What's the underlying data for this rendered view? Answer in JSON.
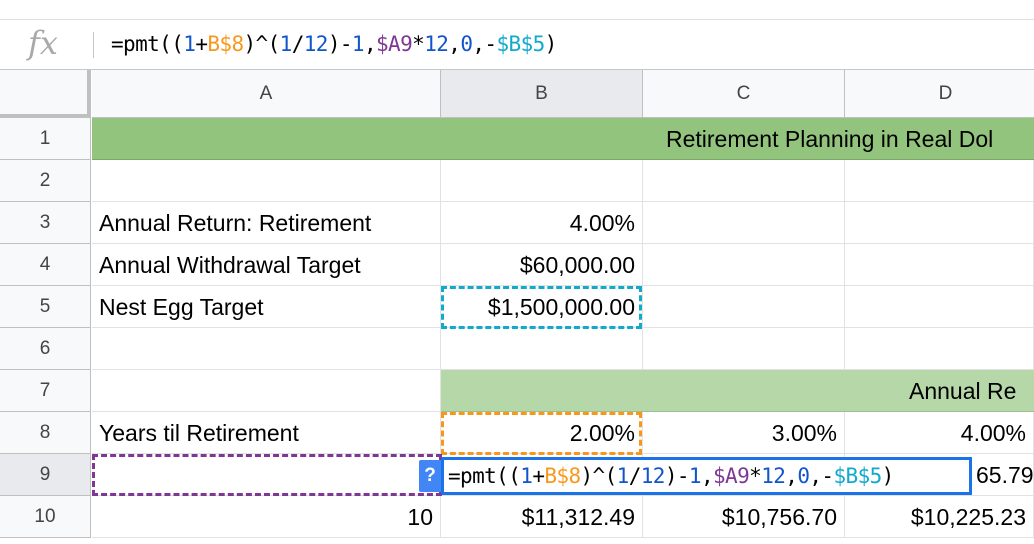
{
  "formula_bar": {
    "fx_label": "fx",
    "tokens": [
      {
        "t": "=pmt((",
        "c": "op"
      },
      {
        "t": "1",
        "c": "num"
      },
      {
        "t": "+",
        "c": "op"
      },
      {
        "t": "B$8",
        "c": "ref1"
      },
      {
        "t": ")^(",
        "c": "op"
      },
      {
        "t": "1",
        "c": "num"
      },
      {
        "t": "/",
        "c": "op"
      },
      {
        "t": "12",
        "c": "num"
      },
      {
        "t": ")-",
        "c": "op"
      },
      {
        "t": "1",
        "c": "num"
      },
      {
        "t": ",",
        "c": "op"
      },
      {
        "t": "$A9",
        "c": "ref2"
      },
      {
        "t": "*",
        "c": "op"
      },
      {
        "t": "12",
        "c": "num"
      },
      {
        "t": ",",
        "c": "op"
      },
      {
        "t": "0",
        "c": "num"
      },
      {
        "t": ",-",
        "c": "op"
      },
      {
        "t": "$B$5",
        "c": "ref3"
      },
      {
        "t": ")",
        "c": "op"
      }
    ]
  },
  "columns": [
    "A",
    "B",
    "C",
    "D"
  ],
  "rows": [
    "1",
    "2",
    "3",
    "4",
    "5",
    "6",
    "7",
    "8",
    "9",
    "10"
  ],
  "title": "Retirement Planning in Real Dol",
  "annual_return_header": "Annual Re",
  "cells": {
    "A3": "Annual Return: Retirement",
    "B3": "4.00%",
    "A4": "Annual Withdrawal Target",
    "B4": "$60,000.00",
    "A5": "Nest Egg Target",
    "B5": "$1,500,000.00",
    "A8": "Years til Retirement",
    "B8": "2.00%",
    "C8": "3.00%",
    "D8": "4.00%",
    "D9": "65.79",
    "A10": "10",
    "B10": "$11,312.49",
    "C10": "$10,756.70",
    "D10": "$10,225.23"
  },
  "editor": {
    "help_label": "?"
  },
  "colors": {
    "ref_b8": "#f7981d",
    "ref_a9": "#7e3794",
    "ref_b5": "#11a9cc",
    "number": "#1155cc",
    "title_band": "#93c47d",
    "return_band": "#b6d7a8",
    "editor_border": "#1a73e8"
  }
}
